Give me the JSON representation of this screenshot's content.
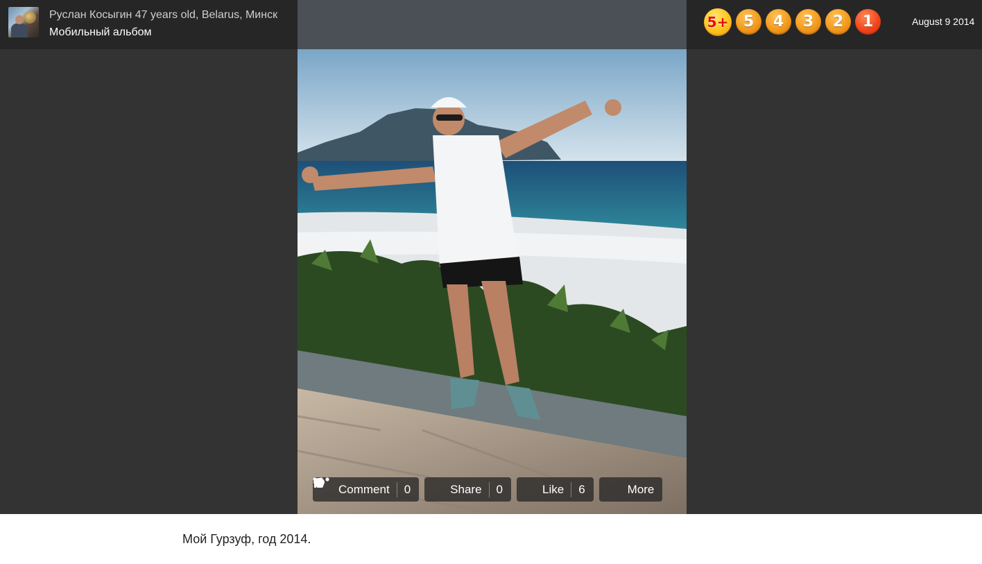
{
  "header": {
    "author_line": "Руслан Косыгин 47 years old, Belarus, Минск",
    "album": "Мобильный альбом",
    "date": "August 9 2014",
    "grades": [
      "5+",
      "5",
      "4",
      "3",
      "2",
      "1"
    ]
  },
  "actions": {
    "comment_label": "Comment",
    "comment_count": "0",
    "share_label": "Share",
    "share_count": "0",
    "like_label": "Like",
    "like_count": "6",
    "more_label": "More"
  },
  "caption": "Мой Гурзуф, год 2014.",
  "icons": {
    "comment": "comment-bubble-icon",
    "share": "share-arrow-icon",
    "like": "thumbs-up-icon",
    "more": "ellipsis-icon"
  },
  "colors": {
    "viewer_bg": "#333333",
    "topbar_bg": "#262626",
    "grade_orange": "#f39a1b",
    "grade_one_red": "#f3451b"
  }
}
